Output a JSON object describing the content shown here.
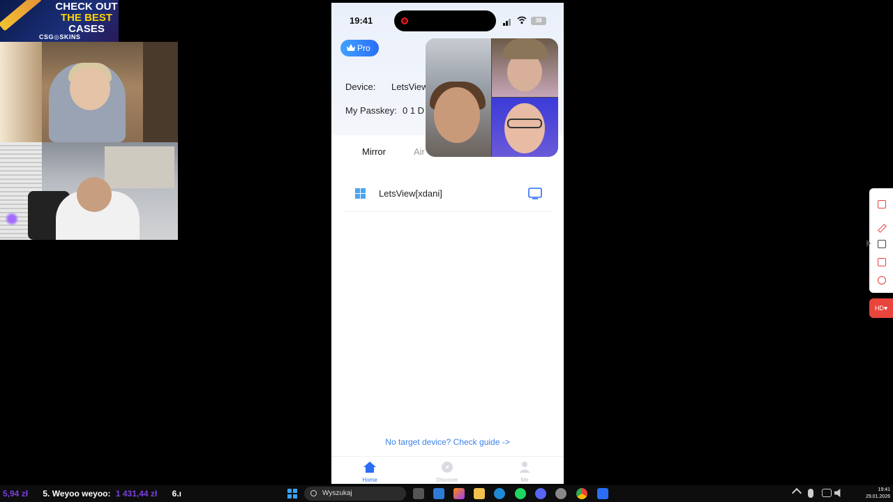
{
  "ad": {
    "line1": "CHECK OUT",
    "line2": "THE BEST",
    "line3": "CASES",
    "brand": "CSG◎SKINS"
  },
  "phone": {
    "status": {
      "time": "19:41",
      "battery": "38"
    },
    "pro_badge": "Pro",
    "device_label": "Device:",
    "device_value": "LetsView",
    "passkey_label": "My Passkey:",
    "passkey_value": "0 1 D",
    "tabs": {
      "mirror": "Mirror",
      "airplay": "Air"
    },
    "device_list": [
      {
        "name": "LetsView[xdani]"
      }
    ],
    "guide": "No target device?  Check guide ->",
    "nav": {
      "home": "Home",
      "discover": "Discover",
      "me": "Me"
    },
    "colors": {
      "accent": "#2a6ef5",
      "link": "#3c82e6"
    }
  },
  "side_toolbar": {
    "hd": "HD♥"
  },
  "taskbar": {
    "ticker_money_1": "5,94 zł",
    "ticker_name": "5. Weyoo weyoo:",
    "ticker_money_2": "1 431,44 zł",
    "ticker_next": "6.ı",
    "search_placeholder": "Wyszukaj",
    "clock_time": "19:41",
    "clock_date": "29.01.2026"
  }
}
